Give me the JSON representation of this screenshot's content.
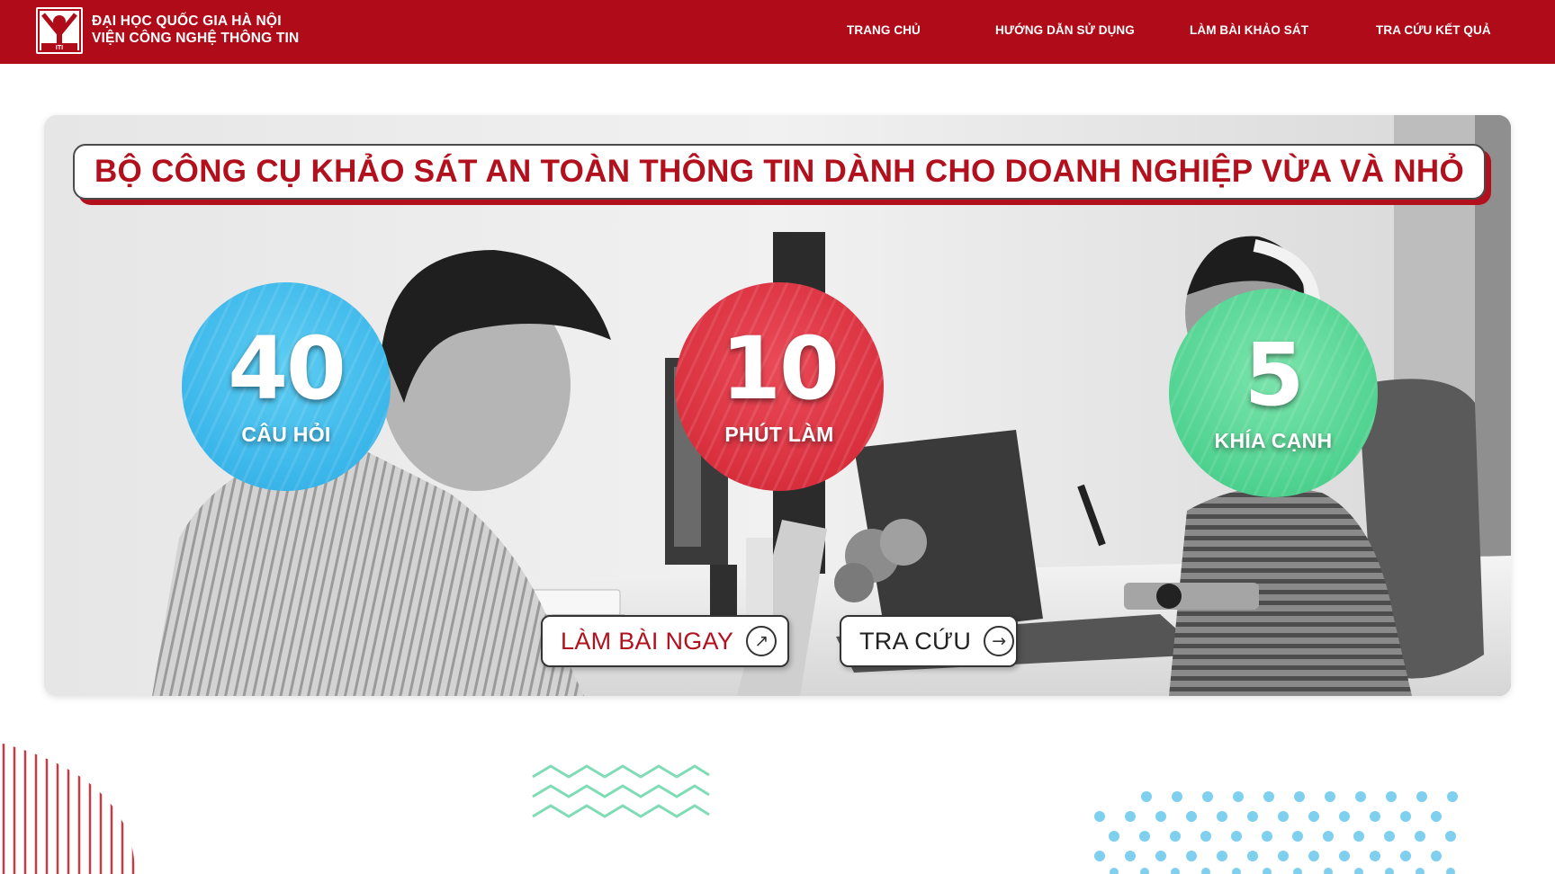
{
  "header": {
    "brand_line1": "ĐẠI HỌC QUỐC GIA HÀ NỘI",
    "brand_line2": "VIỆN CÔNG NGHỆ THÔNG TIN",
    "logo_caption": "ITI",
    "nav": [
      {
        "label": "TRANG CHỦ"
      },
      {
        "label": "HƯỚNG DẪN SỬ DỤNG"
      },
      {
        "label": "LÀM BÀI KHẢO SÁT"
      },
      {
        "label": "TRA CỨU KẾT QUẢ"
      }
    ]
  },
  "hero": {
    "title": "BỘ CÔNG CỤ KHẢO SÁT AN TOÀN THÔNG TIN DÀNH CHO DOANH NGHIỆP VỪA VÀ NHỎ",
    "stats": [
      {
        "value": "40",
        "label": "CÂU HỎI",
        "color": "#3bb6ea"
      },
      {
        "value": "10",
        "label": "PHÚT LÀM",
        "color": "#d9303e"
      },
      {
        "value": "5",
        "label": "KHÍA CẠNH",
        "color": "#4fd28f"
      }
    ],
    "cta_primary": {
      "label": "LÀM BÀI NGAY",
      "icon": "arrow-up-right-icon"
    },
    "cta_secondary": {
      "label": "TRA CỨU",
      "icon": "arrow-right-icon"
    }
  },
  "colors": {
    "brand_red": "#af0b18",
    "title_red": "#b3101e",
    "zigzag_green": "#7fdcb5",
    "dots_blue": "#7fd0ef",
    "stripes_red": "#c43a46"
  }
}
